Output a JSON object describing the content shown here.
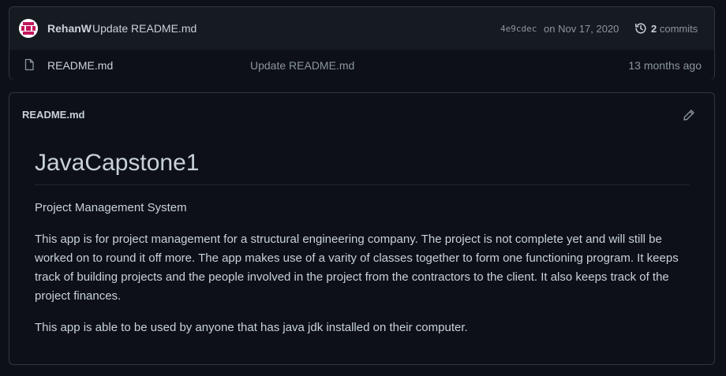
{
  "commit": {
    "author": "RehanW",
    "message": "Update README.md",
    "sha": "4e9cdec",
    "date": "on Nov 17, 2020",
    "commit_count": "2",
    "commits_label": "commits"
  },
  "files": [
    {
      "name": "README.md",
      "last_commit": "Update README.md",
      "age": "13 months ago"
    }
  ],
  "readme": {
    "filename": "README.md",
    "heading": "JavaCapstone1",
    "paragraphs": [
      "Project Management System",
      "This app is for project management for a structural engineering company. The project is not complete yet and will still be worked on to round it off more. The app makes use of a varity of classes together to form one functioning program. It keeps track of building projects and the people involved in the project from the contractors to the client. It also keeps track of the project finances.",
      "This app is able to be used by anyone that has java jdk installed on their computer."
    ]
  },
  "icons": {
    "avatar": "avatar-icon",
    "history": "history-icon",
    "file": "file-icon",
    "edit": "pencil-icon"
  },
  "colors": {
    "background": "#0d1117",
    "panel": "#161b22",
    "border": "#30363d",
    "text": "#c9d1d9",
    "muted": "#8b949e",
    "avatar_accent": "#c2185b"
  }
}
